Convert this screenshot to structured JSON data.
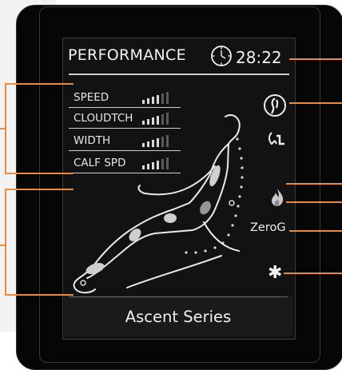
{
  "screen": {
    "title": "PERFORMANCE",
    "time": "28:22",
    "settings": [
      {
        "label": "SPEED",
        "level": 4,
        "max": 6
      },
      {
        "label": "CLOUDTCH",
        "level": 4,
        "max": 6
      },
      {
        "label": "WIDTH",
        "level": 4,
        "max": 6
      },
      {
        "label": "CALF SPD",
        "level": 4,
        "max": 6
      }
    ],
    "side_icons": [
      "body-scan-icon",
      "foot-roller-icon",
      "heat-icon"
    ],
    "zero_g_label": "ZeroG",
    "bluetooth_icon": "bluetooth-icon",
    "series_label": "Ascent Series"
  },
  "colors": {
    "callout_line": "#e88a3f",
    "screen_bg": "#121212",
    "text": "#f2f2f2",
    "device": "#060606"
  }
}
